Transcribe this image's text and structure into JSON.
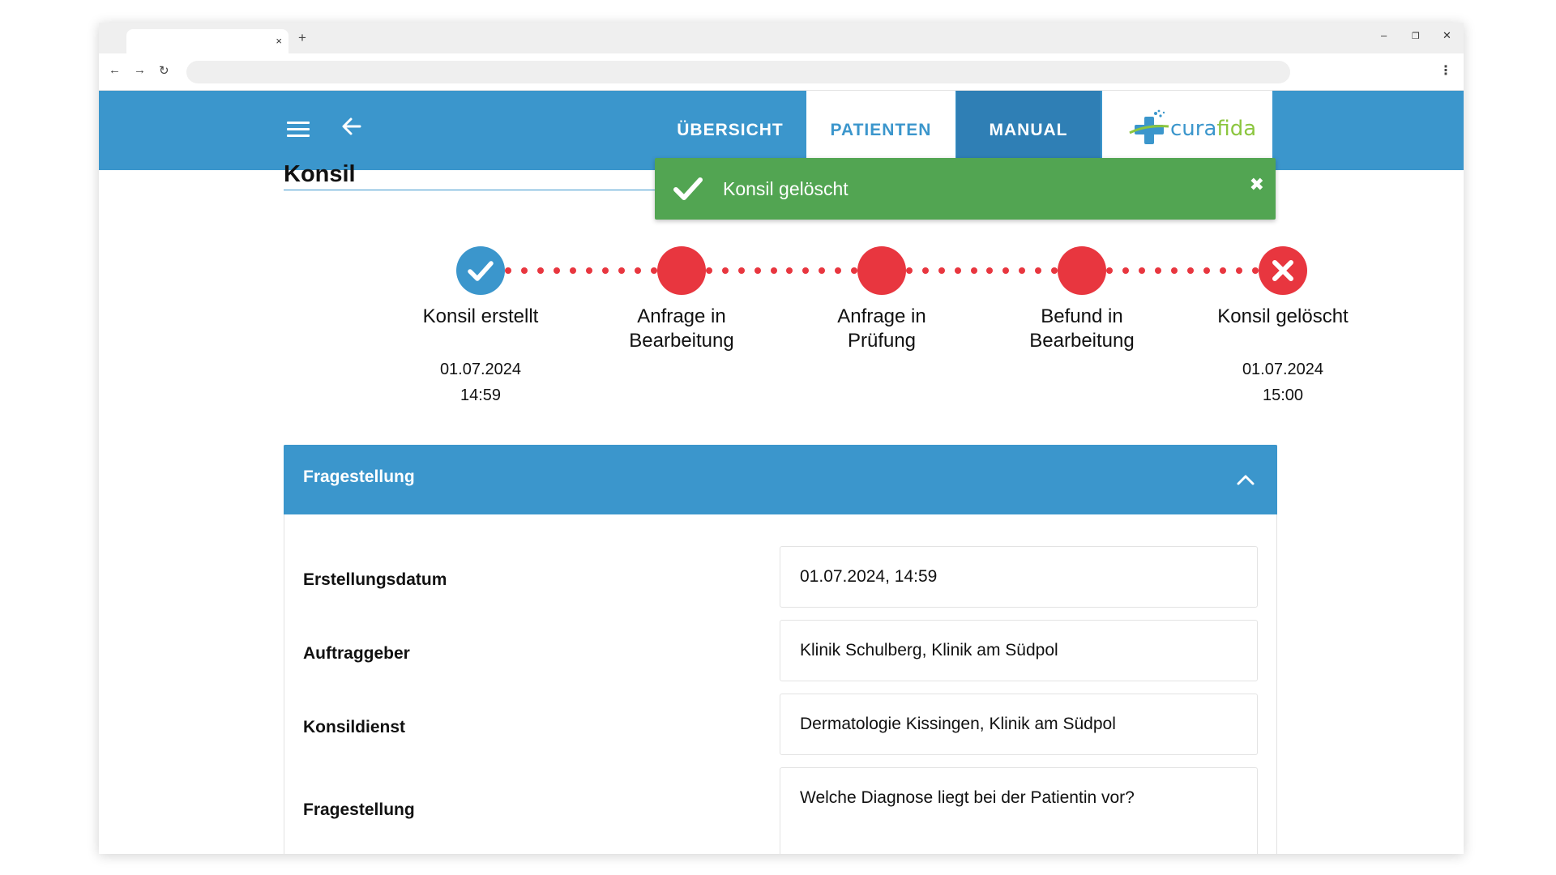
{
  "browser": {
    "tab_close": "×",
    "new_tab": "+",
    "back": "←",
    "forward": "→",
    "reload": "↻",
    "menu": "⋮",
    "minimize": "–",
    "restore": "❐",
    "close": "✕"
  },
  "header": {
    "nav": [
      "ÜBERSICHT",
      "PATIENTEN",
      "MANUAL"
    ],
    "logo": {
      "part1": "cura",
      "part2": "fida"
    }
  },
  "page": {
    "title": "Konsil"
  },
  "toast": {
    "message": "Konsil gelöscht",
    "close": "✖"
  },
  "timeline": [
    {
      "label": "Konsil erstellt",
      "date": "01.07.2024",
      "time": "14:59",
      "state": "done"
    },
    {
      "label": "Anfrage in Bearbeitung",
      "date": "",
      "time": "",
      "state": "pending"
    },
    {
      "label": "Anfrage in Prüfung",
      "date": "",
      "time": "",
      "state": "pending"
    },
    {
      "label": "Befund in Bearbeitung",
      "date": "",
      "time": "",
      "state": "pending"
    },
    {
      "label": "Konsil gelöscht",
      "date": "01.07.2024",
      "time": "15:00",
      "state": "deleted"
    }
  ],
  "panel": {
    "title": "Fragestellung",
    "fields": [
      {
        "label": "Erstellungsdatum",
        "value": "01.07.2024, 14:59"
      },
      {
        "label": "Auftraggeber",
        "value": "Klinik Schulberg, Klinik am Südpol"
      },
      {
        "label": "Konsildienst",
        "value": "Dermatologie Kissingen, Klinik am Südpol"
      },
      {
        "label": "Fragestellung",
        "value": "Welche Diagnose liegt bei der Patientin vor?"
      }
    ]
  },
  "colors": {
    "primary": "#3b96cc",
    "danger": "#e8363f",
    "success": "#52a552",
    "logo_blue": "#3b96cc",
    "logo_green": "#8cc63f"
  }
}
